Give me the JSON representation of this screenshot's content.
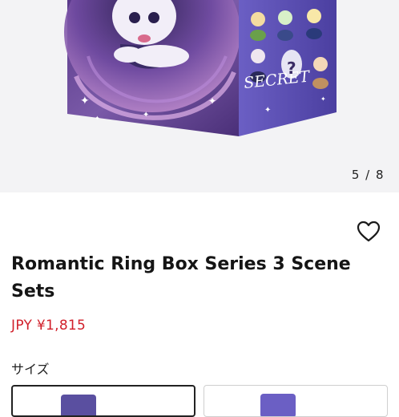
{
  "gallery": {
    "counter": "5 / 8",
    "box_secret_text": "SECRET",
    "box_question_mark": "?"
  },
  "product": {
    "title": "Romantic Ring Box Series 3 Scene Sets",
    "price": "JPY ¥1,815",
    "favorite_icon": "heart-outline-icon"
  },
  "options": {
    "size_label": "サイズ",
    "selected_index": 0
  },
  "colors": {
    "price": "#d11f2a",
    "box_purple": "#5b4aa8",
    "gallery_bg": "#f3f3f5"
  }
}
